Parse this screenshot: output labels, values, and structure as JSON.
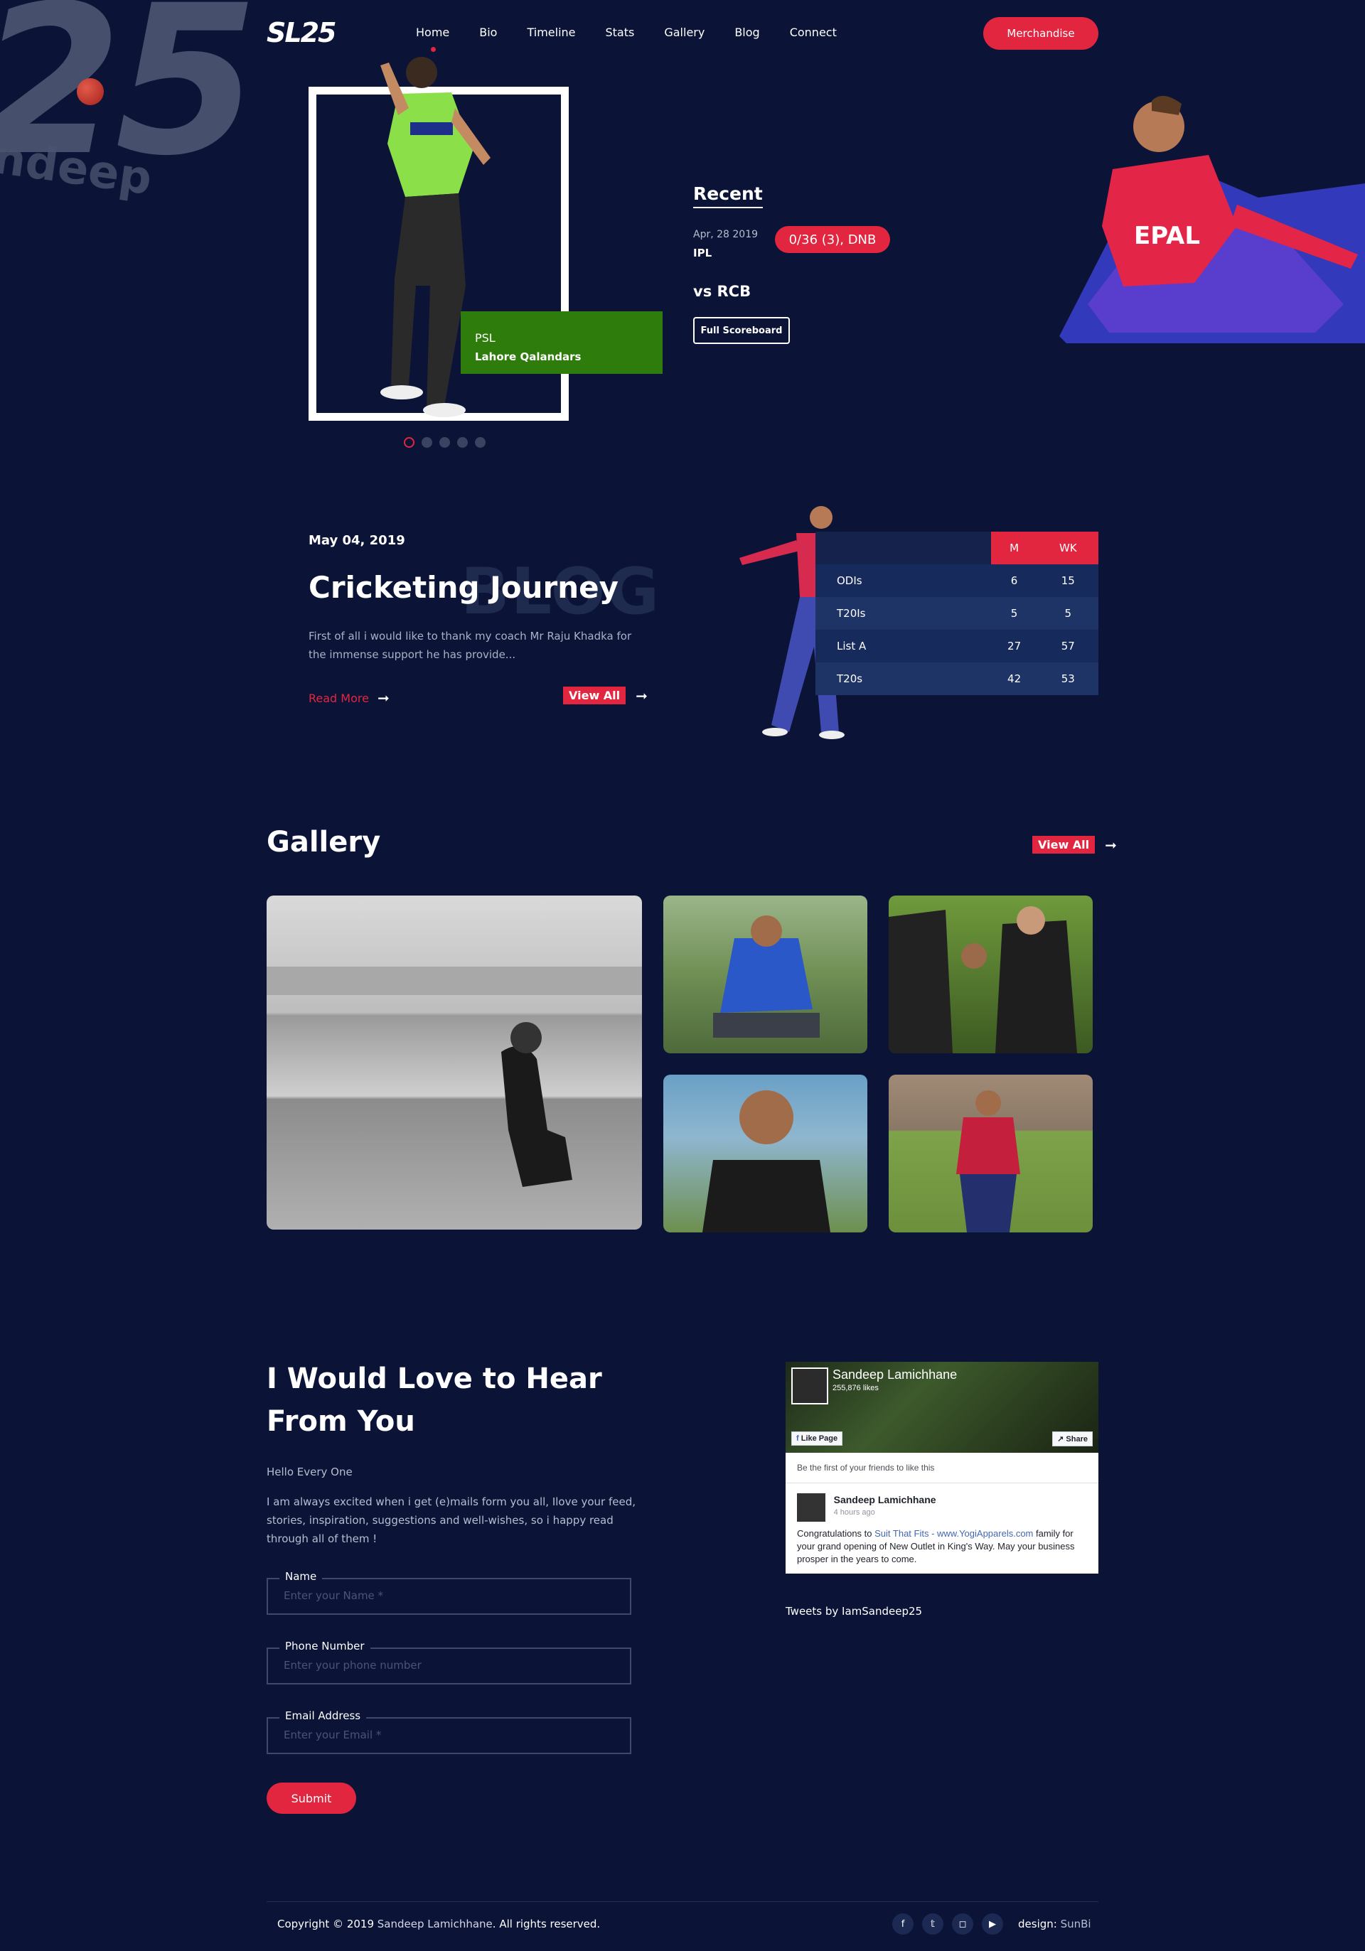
{
  "brand": {
    "logo": "SL25",
    "bg_number": "25",
    "bg_name": "ndeep"
  },
  "nav": {
    "items": [
      "Home",
      "Bio",
      "Timeline",
      "Stats",
      "Gallery",
      "Blog",
      "Connect"
    ],
    "merch": "Merchandise"
  },
  "hero": {
    "team_league": "PSL",
    "team_name": "Lahore Qalandars",
    "recent": {
      "title": "Recent",
      "date": "Apr, 28 2019",
      "league": "IPL",
      "score": "0/36 (3), DNB",
      "opponent": "vs RCB",
      "button": "Full Scoreboard"
    },
    "slides": 5,
    "active_slide": 0
  },
  "blog": {
    "date": "May 04, 2019",
    "watermark": "BLOG",
    "title": "Cricketing Journey",
    "excerpt": "First of all i would like to thank my coach Mr Raju Khadka for the immense support he has provide...",
    "read_more": "Read More",
    "view_all": "View All"
  },
  "stats": {
    "headers": [
      "",
      "M",
      "WK"
    ],
    "rows": [
      [
        "ODIs",
        "6",
        "15"
      ],
      [
        "T20Is",
        "5",
        "5"
      ],
      [
        "List A",
        "27",
        "57"
      ],
      [
        "T20s",
        "42",
        "53"
      ]
    ]
  },
  "gallery": {
    "title": "Gallery",
    "view_all": "View All"
  },
  "contact": {
    "title": "I Would Love to Hear From You",
    "hello": "Hello Every One",
    "body": "I am always excited when i get (e)mails form you all, Ilove your feed, stories, inspiration, suggestions and well-wishes, so i happy read through all of them !",
    "fields": [
      {
        "label": "Name",
        "placeholder": "Enter your Name *"
      },
      {
        "label": "Phone Number",
        "placeholder": "Enter your phone number"
      },
      {
        "label": "Email Address",
        "placeholder": "Enter your Email *"
      }
    ],
    "submit": "Submit"
  },
  "facebook": {
    "page_name": "Sandeep Lamichhane",
    "likes": "255,876 likes",
    "like_page": "Like Page",
    "share": "Share",
    "first": "Be the first of your friends to like this",
    "post_author": "Sandeep Lamichhane",
    "post_time": "4 hours ago",
    "post_prefix": "Congratulations to ",
    "post_link": "Suit That Fits - www.YogiApparels.com",
    "post_rest": "family for your grand opening of New Outlet in King's Way. May your business prosper in the years to come."
  },
  "tweets": "Tweets by IamSandeep25",
  "footer": {
    "copyright_prefix": "Copyright © 2019 ",
    "copyright_name": "Sandeep Lamichhane",
    "copyright_suffix": ". All rights reserved.",
    "design_label": "design: ",
    "design_name": "SunBi",
    "socials": [
      "f",
      "t",
      "i",
      "y"
    ]
  },
  "colors": {
    "bg": "#0b1437",
    "accent": "#e3263f",
    "psl_green": "#2e7d0c"
  }
}
